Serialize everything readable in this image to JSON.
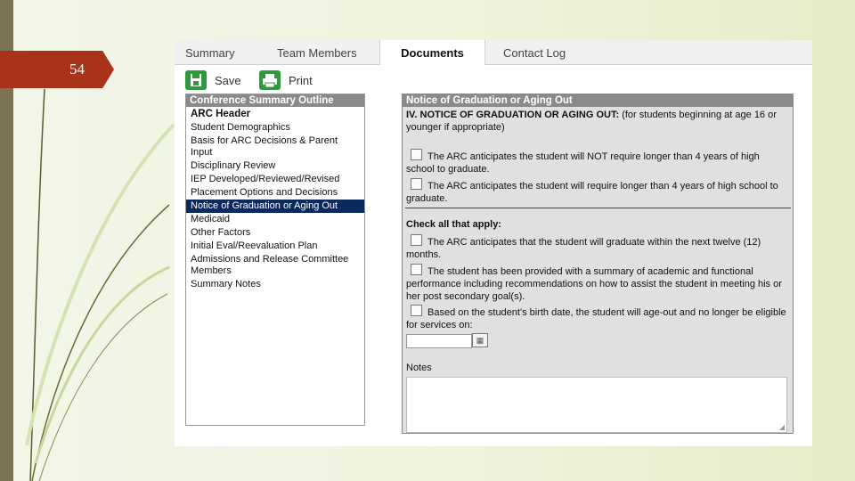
{
  "slide": {
    "number": "54"
  },
  "tabs": [
    {
      "label": "Summary",
      "active": false
    },
    {
      "label": "Team Members",
      "active": false
    },
    {
      "label": "Documents",
      "active": true
    },
    {
      "label": "Contact Log",
      "active": false
    }
  ],
  "toolbar": {
    "save_label": "Save",
    "save_icon": "floppy-icon",
    "print_label": "Print",
    "print_icon": "printer-icon"
  },
  "outline": {
    "header": "Conference Summary Outline",
    "items": [
      "ARC Header",
      "Student Demographics",
      "Basis for ARC Decisions & Parent Input",
      "Disciplinary Review",
      "IEP Developed/Reviewed/Revised",
      "Placement Options and Decisions",
      "Notice of Graduation or Aging Out",
      "Medicaid",
      "Other Factors",
      "Initial Eval/Reevaluation Plan",
      "Admissions and Release Committee Members",
      "Summary Notes"
    ],
    "selected": "Notice of Graduation or Aging Out"
  },
  "form": {
    "header": "Notice of Graduation or Aging Out",
    "section_title": "IV. NOTICE OF GRADUATION OR AGING OUT:",
    "section_note": " (for students beginning at age 16 or younger if appropriate)",
    "option_1": "The ARC anticipates the student will NOT require longer than 4 years of high school to graduate.",
    "option_2": "The ARC anticipates the student will require longer than 4 years of high school to graduate.",
    "check_all": "Check all that apply:",
    "check_1": "The ARC anticipates that the student will graduate within the next twelve (12) months.",
    "check_2": "The student has been provided with a summary of academic and functional performance including recommendations on how to assist the student in meeting his or her post secondary goal(s).",
    "check_3": "Based on the student's birth date, the student will age-out and no longer be eligible for services on:",
    "date_value": "",
    "notes_label": "Notes",
    "notes_value": ""
  },
  "colors": {
    "accent": "#0a2a5e",
    "slide_badge": "#a8331a",
    "panel_header": "#8a8a8a",
    "toolbar_icon": "#2f9a3c"
  }
}
